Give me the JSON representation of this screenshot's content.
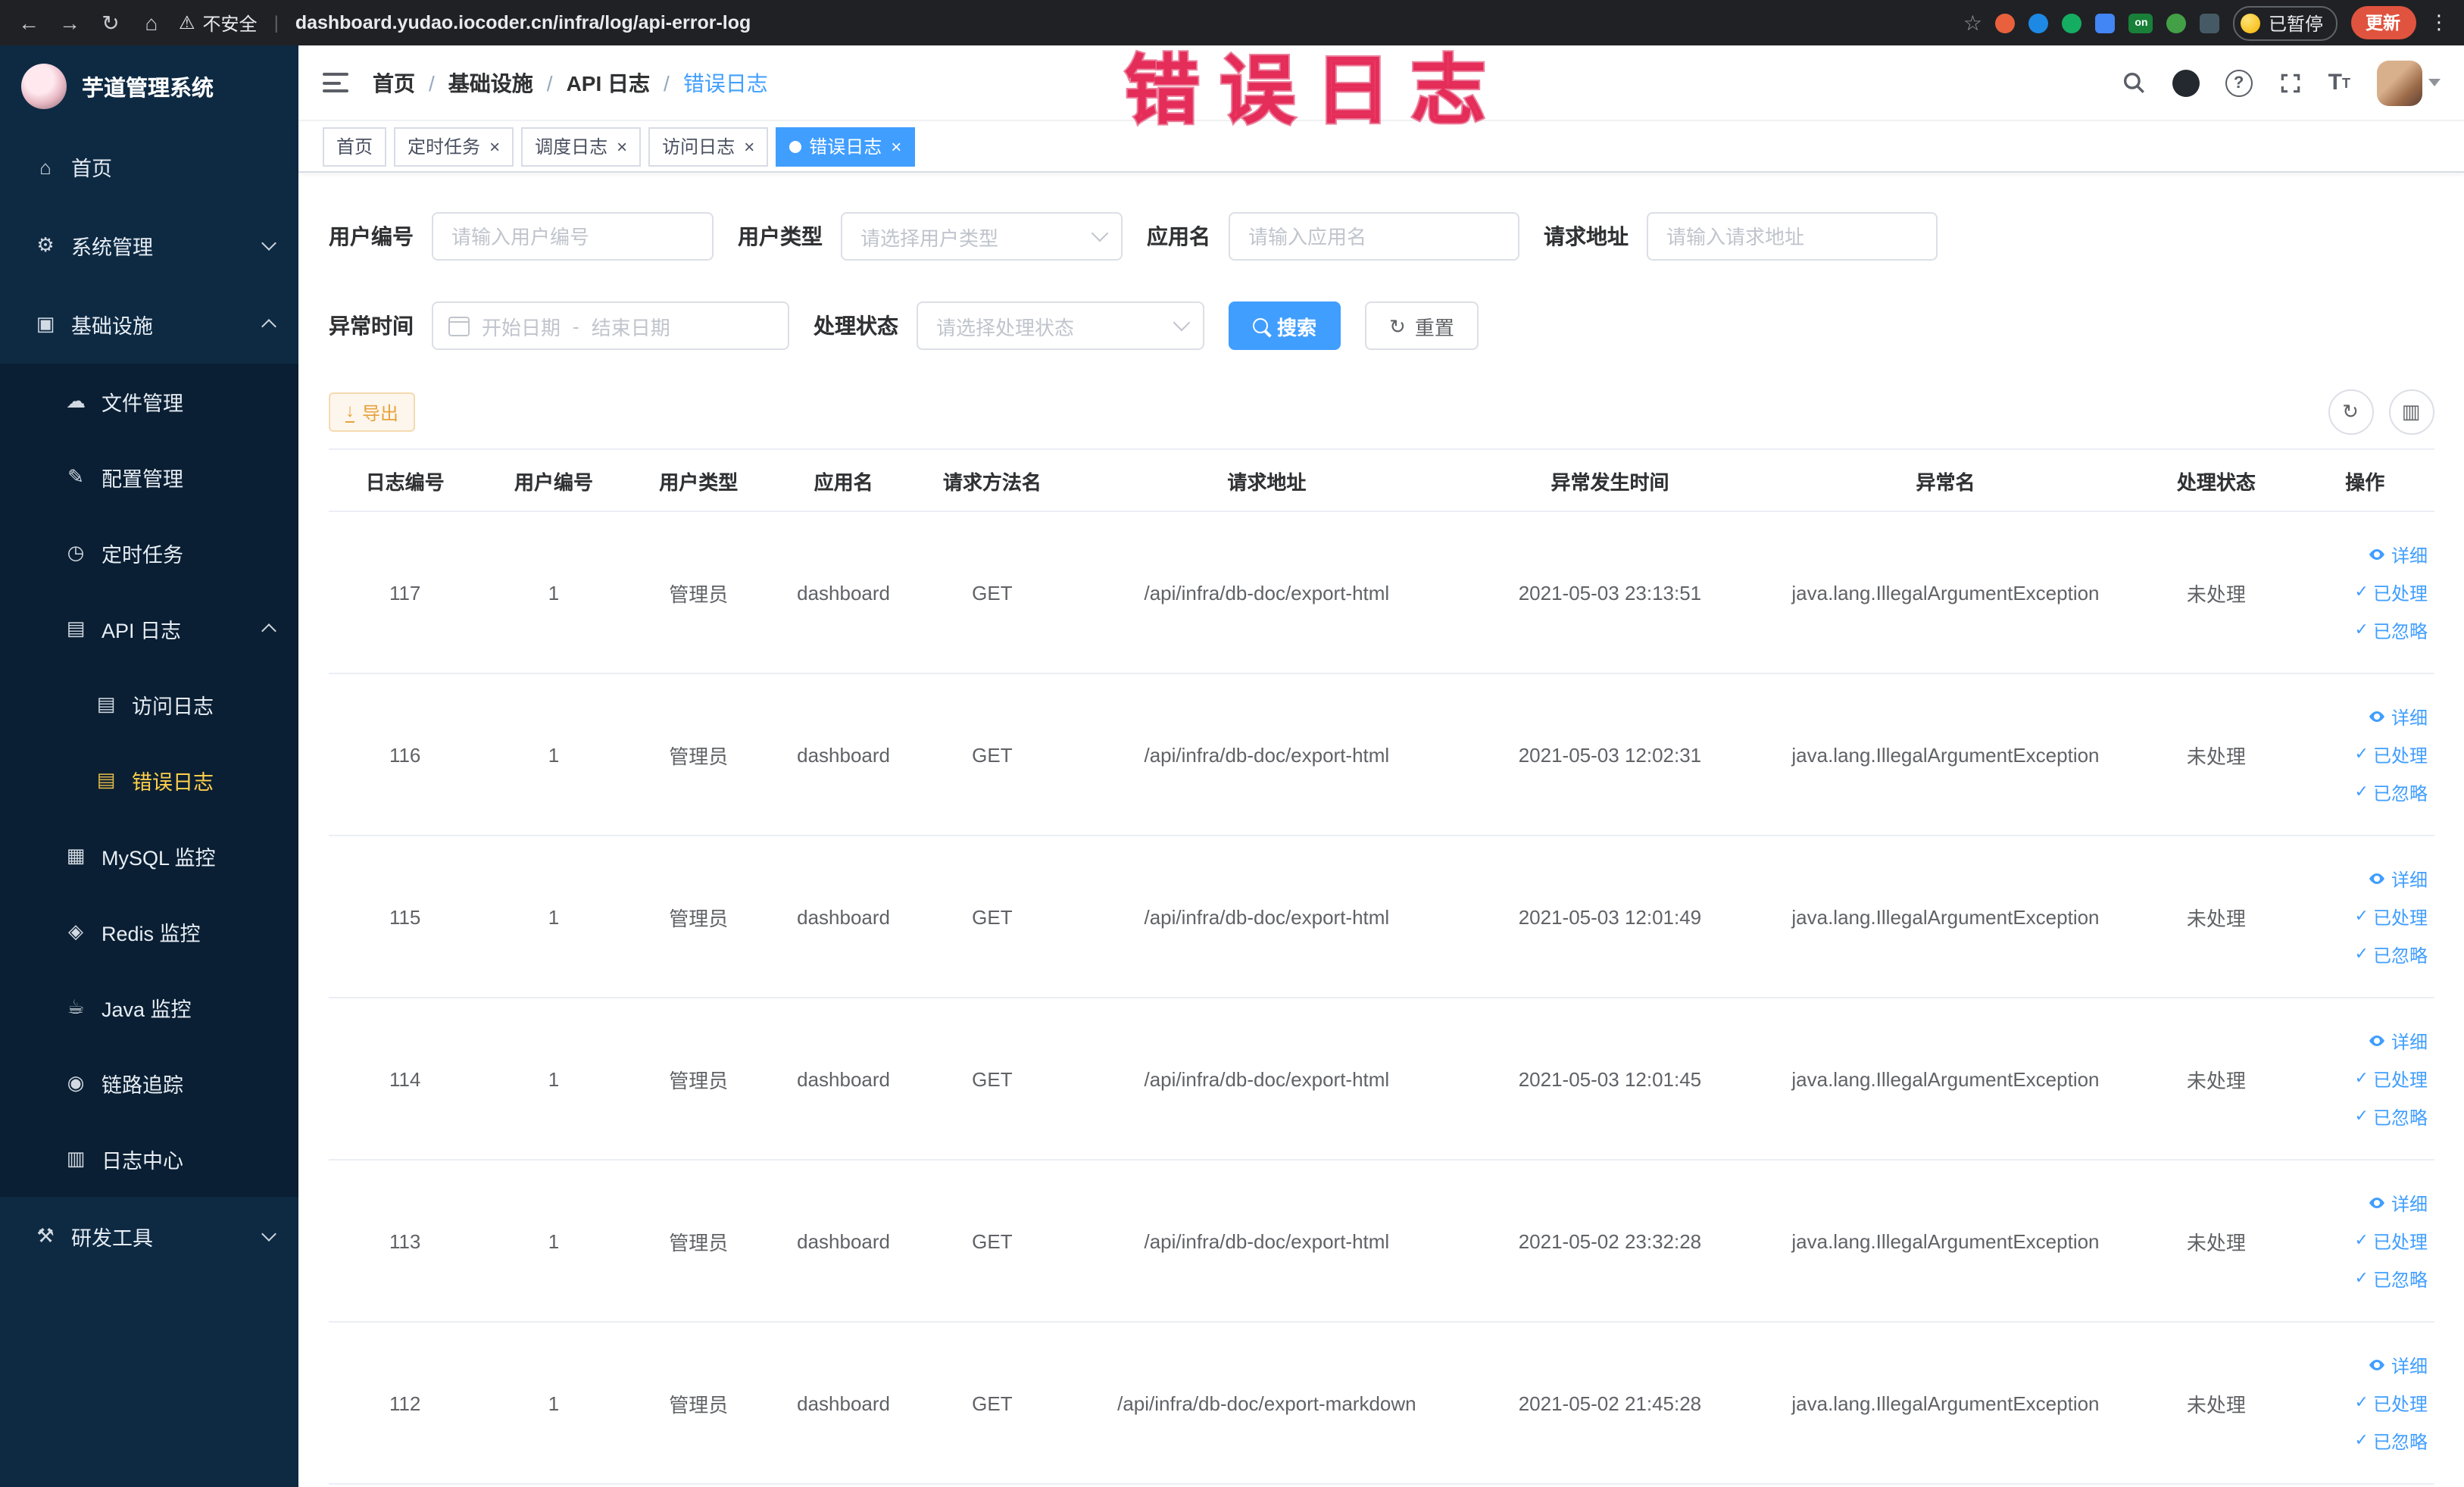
{
  "colors": {
    "primary": "#409eff",
    "sidebar_bg": "#0e2a43",
    "sidebar_sub_bg": "#0a1f33",
    "sidebar_active_text": "#ffd04b",
    "annotation_red": "#f2456b",
    "warning": "#e6a23c",
    "chrome_bg": "#202124",
    "update_button_bg": "#e0533f",
    "active_tab_bg": "#409eff"
  },
  "annotation": {
    "text": "错误日志"
  },
  "browser": {
    "security_label": "不安全",
    "url": "dashboard.yudao.iocoder.cn/infra/log/api-error-log",
    "paused_badge": "已暂停",
    "update_button": "更新"
  },
  "sidebar": {
    "logo_title": "芋道管理系统",
    "menu": [
      {
        "label": "首页",
        "icon": "home-icon",
        "glyph": "⌂",
        "level": 1
      },
      {
        "label": "系统管理",
        "icon": "gear-icon",
        "glyph": "⚙",
        "level": 1,
        "arrow": "down"
      },
      {
        "label": "基础设施",
        "icon": "infrastructure-icon",
        "glyph": "▣",
        "level": 1,
        "arrow": "up"
      },
      {
        "label": "文件管理",
        "icon": "file-manage-icon",
        "glyph": "☁",
        "level": 2
      },
      {
        "label": "配置管理",
        "icon": "config-manage-icon",
        "glyph": "✎",
        "level": 2
      },
      {
        "label": "定时任务",
        "icon": "scheduled-job-icon",
        "glyph": "◷",
        "level": 2
      },
      {
        "label": "API 日志",
        "icon": "api-log-icon",
        "glyph": "▤",
        "level": 2,
        "arrow": "up"
      },
      {
        "label": "访问日志",
        "icon": "access-log-icon",
        "glyph": "▤",
        "level": 3
      },
      {
        "label": "错误日志",
        "icon": "error-log-icon",
        "glyph": "▤",
        "level": 3,
        "active": true
      },
      {
        "label": "MySQL 监控",
        "icon": "mysql-monitor-icon",
        "glyph": "▦",
        "level": 2
      },
      {
        "label": "Redis 监控",
        "icon": "redis-monitor-icon",
        "glyph": "◈",
        "level": 2
      },
      {
        "label": "Java 监控",
        "icon": "java-monitor-icon",
        "glyph": "☕",
        "level": 2
      },
      {
        "label": "链路追踪",
        "icon": "trace-icon",
        "glyph": "◉",
        "level": 2
      },
      {
        "label": "日志中心",
        "icon": "log-center-icon",
        "glyph": "▥",
        "level": 2
      },
      {
        "label": "研发工具",
        "icon": "dev-tools-icon",
        "glyph": "⚒",
        "level": 1,
        "arrow": "down"
      }
    ]
  },
  "header": {
    "breadcrumb": [
      "首页",
      "基础设施",
      "API 日志",
      "错误日志"
    ]
  },
  "tabs": [
    {
      "label": "首页",
      "closable": false,
      "active": false
    },
    {
      "label": "定时任务",
      "closable": true,
      "active": false
    },
    {
      "label": "调度日志",
      "closable": true,
      "active": false
    },
    {
      "label": "访问日志",
      "closable": true,
      "active": false
    },
    {
      "label": "错误日志",
      "closable": true,
      "active": true
    }
  ],
  "filters": {
    "user_id": {
      "label": "用户编号",
      "placeholder": "请输入用户编号"
    },
    "user_type": {
      "label": "用户类型",
      "placeholder": "请选择用户类型"
    },
    "app_name": {
      "label": "应用名",
      "placeholder": "请输入应用名"
    },
    "request_url": {
      "label": "请求地址",
      "placeholder": "请输入请求地址"
    },
    "exception_time": {
      "label": "异常时间",
      "start_placeholder": "开始日期",
      "separator": "-",
      "end_placeholder": "结束日期"
    },
    "process_status": {
      "label": "处理状态",
      "placeholder": "请选择处理状态"
    },
    "search_button": "搜索",
    "reset_button": "重置"
  },
  "toolbar": {
    "export_button": "导出"
  },
  "table": {
    "columns": [
      "日志编号",
      "用户编号",
      "用户类型",
      "应用名",
      "请求方法名",
      "请求地址",
      "异常发生时间",
      "异常名",
      "处理状态",
      "操作"
    ],
    "actions": {
      "detail": "详细",
      "processed": "已处理",
      "ignored": "已忽略"
    },
    "rows": [
      {
        "id": "117",
        "user_id": "1",
        "user_type": "管理员",
        "app": "dashboard",
        "method": "GET",
        "url": "/api/infra/db-doc/export-html",
        "time": "2021-05-03 23:13:51",
        "exception": "java.lang.IllegalArgumentException",
        "status": "未处理"
      },
      {
        "id": "116",
        "user_id": "1",
        "user_type": "管理员",
        "app": "dashboard",
        "method": "GET",
        "url": "/api/infra/db-doc/export-html",
        "time": "2021-05-03 12:02:31",
        "exception": "java.lang.IllegalArgumentException",
        "status": "未处理"
      },
      {
        "id": "115",
        "user_id": "1",
        "user_type": "管理员",
        "app": "dashboard",
        "method": "GET",
        "url": "/api/infra/db-doc/export-html",
        "time": "2021-05-03 12:01:49",
        "exception": "java.lang.IllegalArgumentException",
        "status": "未处理"
      },
      {
        "id": "114",
        "user_id": "1",
        "user_type": "管理员",
        "app": "dashboard",
        "method": "GET",
        "url": "/api/infra/db-doc/export-html",
        "time": "2021-05-03 12:01:45",
        "exception": "java.lang.IllegalArgumentException",
        "status": "未处理"
      },
      {
        "id": "113",
        "user_id": "1",
        "user_type": "管理员",
        "app": "dashboard",
        "method": "GET",
        "url": "/api/infra/db-doc/export-html",
        "time": "2021-05-02 23:32:28",
        "exception": "java.lang.IllegalArgumentException",
        "status": "未处理"
      },
      {
        "id": "112",
        "user_id": "1",
        "user_type": "管理员",
        "app": "dashboard",
        "method": "GET",
        "url": "/api/infra/db-doc/export-markdown",
        "time": "2021-05-02 21:45:28",
        "exception": "java.lang.IllegalArgumentException",
        "status": "未处理"
      }
    ]
  }
}
